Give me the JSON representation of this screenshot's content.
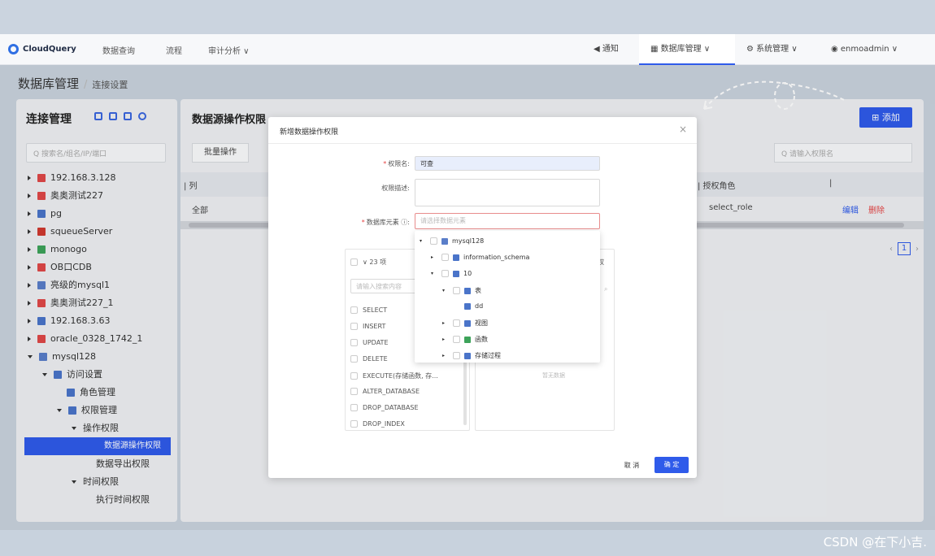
{
  "watermark": "CSDN @在下小吉.",
  "nav": {
    "logo": "CloudQuery",
    "items": [
      "数据查询",
      "流程",
      "审计分析 ∨"
    ],
    "right": {
      "notice": "通知",
      "db_manage": "数据库管理 ∨",
      "sys_manage": "系统管理 ∨",
      "user": "enmoadmin ∨"
    }
  },
  "breadcrumb": {
    "main": "数据库管理",
    "sep": "/",
    "sub": "连接设置"
  },
  "left": {
    "title": "连接管理",
    "search_placeholder": "搜索名/组名/IP/端口",
    "tree": [
      {
        "label": "192.168.3.128",
        "color": "#e04848",
        "level": 0,
        "caret": "right"
      },
      {
        "label": "奥奥测试227",
        "color": "#e04848",
        "level": 0,
        "caret": "right"
      },
      {
        "label": "pg",
        "color": "#4a74c9",
        "level": 0,
        "caret": "right"
      },
      {
        "label": "squeueServer",
        "color": "#d0392f",
        "level": 0,
        "caret": "right"
      },
      {
        "label": "monogo",
        "color": "#3da35a",
        "level": 0,
        "caret": "right"
      },
      {
        "label": "OB口CDB",
        "color": "#e04848",
        "level": 0,
        "caret": "right"
      },
      {
        "label": "亮级的mysql1",
        "color": "#5a7ec9",
        "level": 0,
        "caret": "right"
      },
      {
        "label": "奥奥测试227_1",
        "color": "#e04848",
        "level": 0,
        "caret": "right"
      },
      {
        "label": "192.168.3.63",
        "color": "#4a74c9",
        "level": 0,
        "caret": "right"
      },
      {
        "label": "oracle_0328_1742_1",
        "color": "#e04848",
        "level": 0,
        "caret": "right"
      },
      {
        "label": "mysql128",
        "color": "#5a7ec9",
        "level": 0,
        "caret": "down"
      },
      {
        "label": "访问设置",
        "color": "#4a74c9",
        "level": 1,
        "caret": "down"
      },
      {
        "label": "角色管理",
        "color": "#4a74c9",
        "level": 2,
        "caret": ""
      },
      {
        "label": "权限管理",
        "color": "#4a74c9",
        "level": 2,
        "caret": "down"
      },
      {
        "label": "操作权限",
        "color": "",
        "level": 3,
        "caret": "down"
      },
      {
        "label": "数据源操作权限",
        "color": "",
        "level": 4,
        "caret": "",
        "selected": true
      },
      {
        "label": "数据导出权限",
        "color": "",
        "level": 4,
        "caret": ""
      },
      {
        "label": "时间权限",
        "color": "",
        "level": 3,
        "caret": "down"
      },
      {
        "label": "执行时间权限",
        "color": "",
        "level": 4,
        "caret": ""
      }
    ]
  },
  "right": {
    "title": "数据源操作权限",
    "batch": "批量操作",
    "add": "⊞ 添加",
    "search_placeholder": "Q 请输入权限名",
    "columns": [
      "| 列",
      "| 授权角色",
      "|"
    ],
    "row": {
      "col": "全部",
      "role": "select_role",
      "edit": "编辑",
      "delete": "删除"
    },
    "page": "1"
  },
  "modal": {
    "title": "新增数据操作权限",
    "close": "×",
    "name_label": "权限名:",
    "name_value": "可查",
    "desc_label": "权限描述:",
    "scope_label": "数据库元素",
    "scope_placeholder": "请选择数据元素",
    "ops_header": "∨ 23 项",
    "ops_search": "请输入搜索内容",
    "right_header": "权",
    "right_empty": "暂无数据",
    "ops": [
      "SELECT",
      "INSERT",
      "UPDATE",
      "DELETE",
      "EXECUTE(存储函数, 存...",
      "ALTER_DATABASE",
      "DROP_DATABASE",
      "DROP_INDEX"
    ],
    "cancel": "取 消",
    "ok": "确 定",
    "dropdown": [
      {
        "label": "mysql128",
        "level": 0,
        "caret": "▾",
        "color": "#5a7ec9"
      },
      {
        "label": "information_schema",
        "level": 1,
        "caret": "▸",
        "color": "#4a74c9"
      },
      {
        "label": "10",
        "level": 1,
        "caret": "▾",
        "color": "#4a74c9"
      },
      {
        "label": "表",
        "level": 2,
        "caret": "▾",
        "color": "#4a74c9"
      },
      {
        "label": "dd",
        "level": 3,
        "caret": "",
        "color": "#4a74c9"
      },
      {
        "label": "视图",
        "level": 2,
        "caret": "▸",
        "color": "#4a74c9"
      },
      {
        "label": "函数",
        "level": 2,
        "caret": "▸",
        "color": "#3da35a"
      },
      {
        "label": "存储过程",
        "level": 2,
        "caret": "▸",
        "color": "#4a74c9"
      }
    ]
  }
}
